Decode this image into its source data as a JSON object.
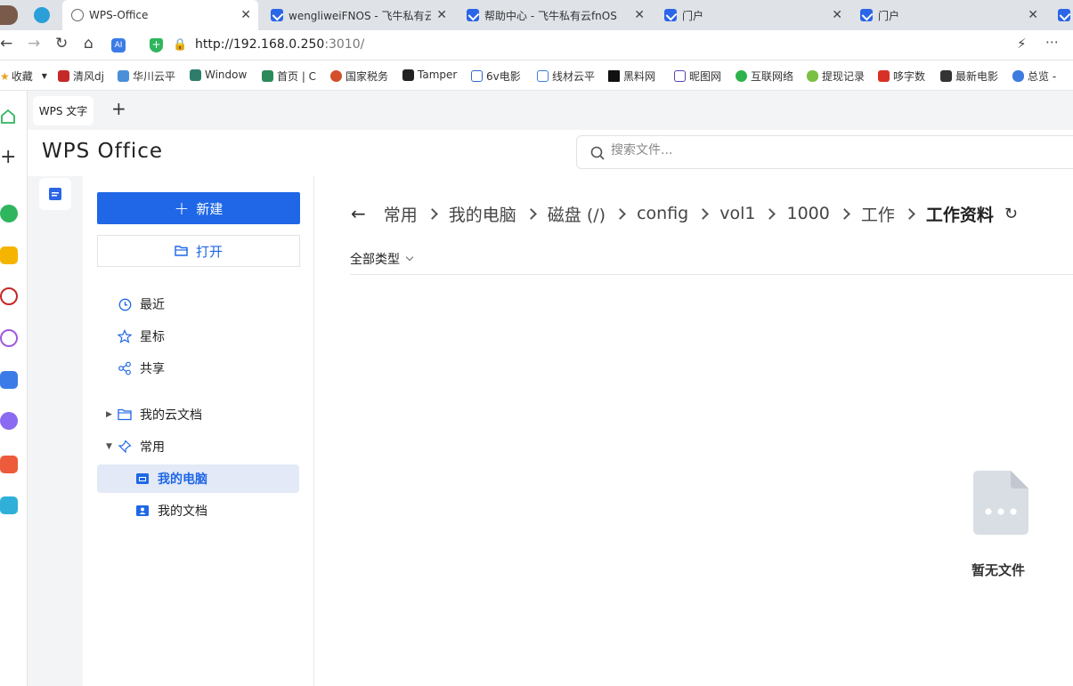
{
  "browser": {
    "tabs": [
      {
        "title": "WPS-Office",
        "active": true
      },
      {
        "title": "wengliweiFNOS - 飞牛私有云"
      },
      {
        "title": "帮助中心 - 飞牛私有云fnOS"
      },
      {
        "title": "门户"
      },
      {
        "title": "门户"
      }
    ],
    "url_host": "http://192.168.0.250",
    "url_rest": ":3010/",
    "bookmarks": [
      "收藏",
      "清风dj",
      "华川云平",
      "Window",
      "首页 | C",
      "国家税务",
      "Tamper",
      "6v电影",
      "线材云平",
      "黑料网",
      "昵图网",
      "互联网络",
      "提现记录",
      "哆字数",
      "最新电影",
      "总览 -"
    ]
  },
  "wps": {
    "tab_label": "WPS 文字",
    "logo": "WPS Office",
    "search_placeholder": "搜索文件...",
    "new_label": "新建",
    "open_label": "打开",
    "nav": {
      "recent": "最近",
      "starred": "星标",
      "shared": "共享",
      "cloud_docs": "我的云文档",
      "common": "常用",
      "my_computer": "我的电脑",
      "my_docs": "我的文档"
    },
    "breadcrumb": [
      "常用",
      "我的电脑",
      "磁盘 (/)",
      "config",
      "vol1",
      "1000",
      "工作",
      "工作资料"
    ],
    "filter_label": "全部类型",
    "empty_text": "暂无文件"
  },
  "colors": {
    "accent": "#1f67e6",
    "selected_bg": "#e3e9f6"
  }
}
